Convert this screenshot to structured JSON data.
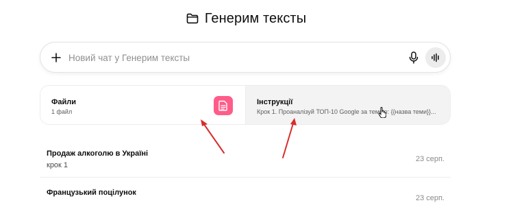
{
  "header": {
    "title": "Генерим тексты",
    "icon": "folder-icon"
  },
  "composer": {
    "placeholder": "Новий чат у Генерим тексты",
    "value": "",
    "plus_icon": "plus-icon",
    "mic_icon": "microphone-icon",
    "voice_icon": "voice-waveform-icon"
  },
  "cards": {
    "files": {
      "title": "Файли",
      "subtitle": "1 файл",
      "badge_icon": "document-icon",
      "badge_color": "#ff5c8a"
    },
    "instructions": {
      "title": "Інструкції",
      "subtitle": "Крок 1. Проаналізуй ТОП-10 Google за темою: {{назва теми}}..."
    }
  },
  "chats": [
    {
      "title": "Продаж алкоголю в Україні",
      "subtitle": "крок 1",
      "date": "23 серп."
    },
    {
      "title": "Французький поцілунок",
      "subtitle": "",
      "date": "23 серп."
    }
  ],
  "annotations": {
    "arrow_color": "#d92b2b"
  }
}
